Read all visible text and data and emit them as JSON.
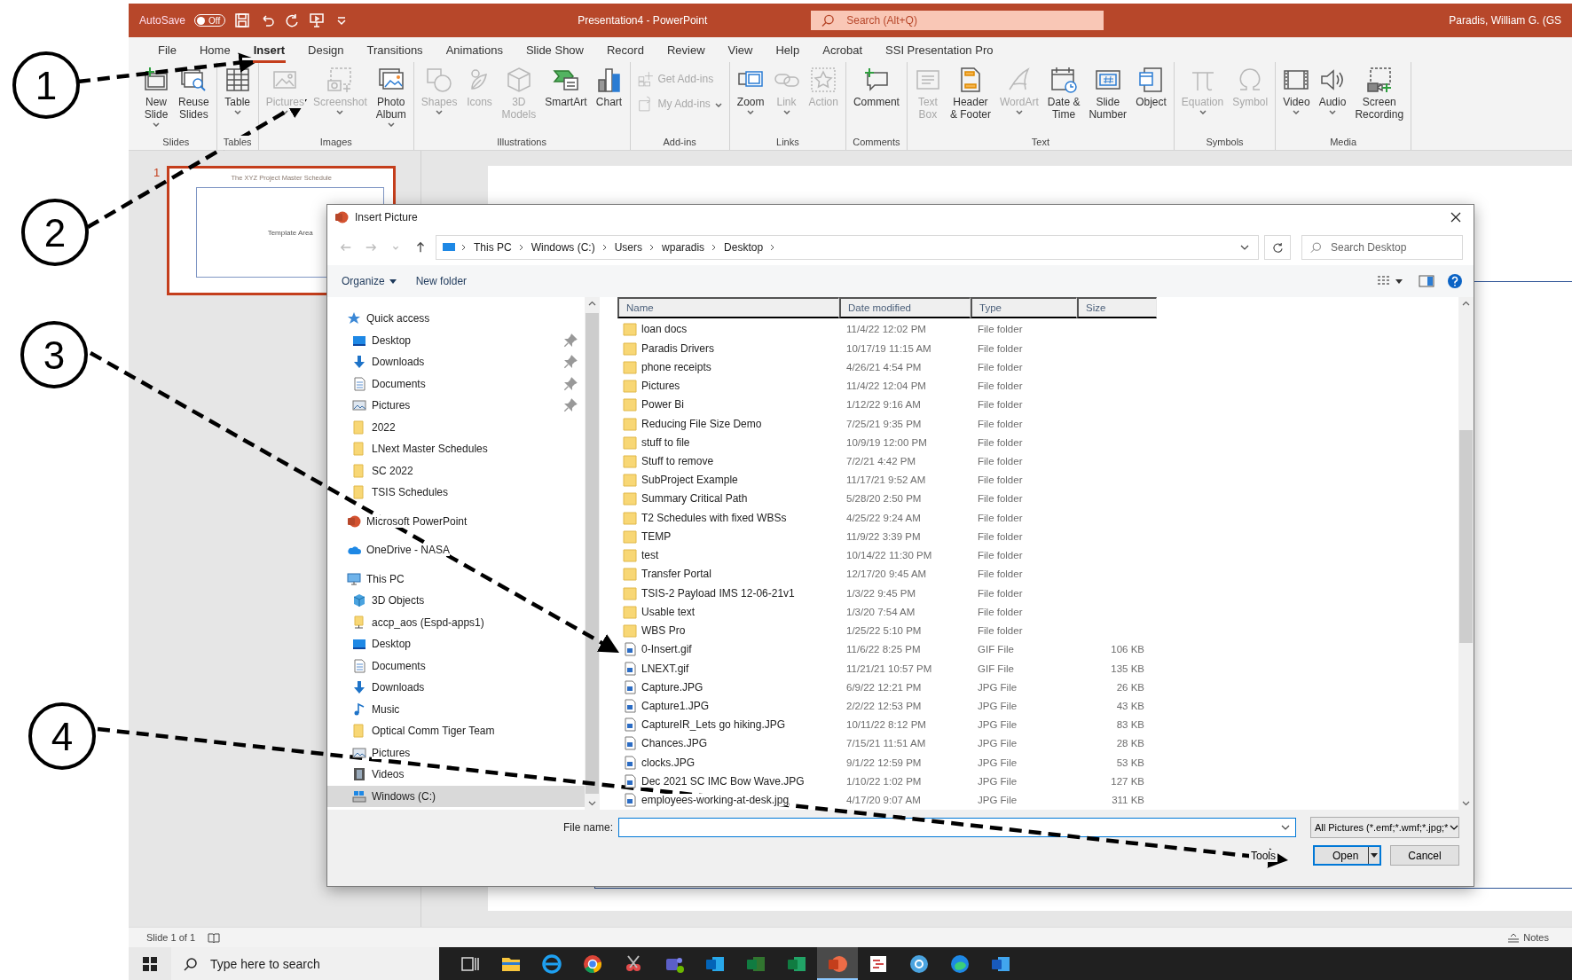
{
  "title_bar": {
    "autosave": {
      "label": "AutoSave",
      "toggle": "Off",
      "on": false
    },
    "title": "Presentation4  -  PowerPoint",
    "search": {
      "placeholder": "Search (Alt+Q)"
    },
    "user": "Paradis, William G. (GS"
  },
  "tabs": [
    {
      "label": "File",
      "selected": false
    },
    {
      "label": "Home",
      "selected": false
    },
    {
      "label": "Insert",
      "selected": true
    },
    {
      "label": "Design",
      "selected": false
    },
    {
      "label": "Transitions",
      "selected": false
    },
    {
      "label": "Animations",
      "selected": false
    },
    {
      "label": "Slide Show",
      "selected": false
    },
    {
      "label": "Record",
      "selected": false
    },
    {
      "label": "Review",
      "selected": false
    },
    {
      "label": "View",
      "selected": false
    },
    {
      "label": "Help",
      "selected": false
    },
    {
      "label": "Acrobat",
      "selected": false
    },
    {
      "label": "SSI Presentation Pro",
      "selected": false
    }
  ],
  "ribbon": {
    "groups": [
      {
        "label": "Slides",
        "buttons": [
          {
            "label": "New\nSlide",
            "kind": "large",
            "disabled": false,
            "dropdown": true
          },
          {
            "label": "Reuse\nSlides",
            "kind": "large",
            "disabled": false,
            "dropdown": false
          }
        ]
      },
      {
        "label": "Tables",
        "buttons": [
          {
            "label": "Table",
            "kind": "large",
            "disabled": false,
            "dropdown": true
          }
        ]
      },
      {
        "label": "Images",
        "buttons": [
          {
            "label": "Pictures",
            "kind": "large",
            "disabled": true,
            "dropdown": true
          },
          {
            "label": "Screenshot",
            "kind": "large",
            "disabled": true,
            "dropdown": true
          },
          {
            "label": "Photo\nAlbum",
            "kind": "large",
            "disabled": false,
            "dropdown": true
          }
        ]
      },
      {
        "label": "Illustrations",
        "buttons": [
          {
            "label": "Shapes",
            "kind": "large",
            "disabled": true,
            "dropdown": true
          },
          {
            "label": "Icons",
            "kind": "large",
            "disabled": true,
            "dropdown": false
          },
          {
            "label": "3D\nModels",
            "kind": "large",
            "disabled": true,
            "dropdown": false
          },
          {
            "label": "SmartArt",
            "kind": "large",
            "disabled": false,
            "dropdown": false
          },
          {
            "label": "Chart",
            "kind": "large",
            "disabled": false,
            "dropdown": false
          }
        ]
      },
      {
        "label": "Add-ins",
        "buttons": [
          {
            "label": "Get Add-ins",
            "kind": "small",
            "disabled": true,
            "dropdown": false
          },
          {
            "label": "My Add-ins",
            "kind": "small",
            "disabled": true,
            "dropdown": true
          }
        ]
      },
      {
        "label": "Links",
        "buttons": [
          {
            "label": "Zoom",
            "kind": "large",
            "disabled": false,
            "dropdown": true
          },
          {
            "label": "Link",
            "kind": "large",
            "disabled": true,
            "dropdown": true
          },
          {
            "label": "Action",
            "kind": "large",
            "disabled": true,
            "dropdown": false
          }
        ]
      },
      {
        "label": "Comments",
        "buttons": [
          {
            "label": "Comment",
            "kind": "large",
            "disabled": false,
            "dropdown": false
          }
        ]
      },
      {
        "label": "Text",
        "buttons": [
          {
            "label": "Text\nBox",
            "kind": "large",
            "disabled": true,
            "dropdown": false
          },
          {
            "label": "Header\n& Footer",
            "kind": "large",
            "disabled": false,
            "dropdown": false
          },
          {
            "label": "WordArt",
            "kind": "large",
            "disabled": true,
            "dropdown": true
          },
          {
            "label": "Date &\nTime",
            "kind": "large",
            "disabled": false,
            "dropdown": false
          },
          {
            "label": "Slide\nNumber",
            "kind": "large",
            "disabled": false,
            "dropdown": false
          },
          {
            "label": "Object",
            "kind": "large",
            "disabled": false,
            "dropdown": false
          }
        ]
      },
      {
        "label": "Symbols",
        "buttons": [
          {
            "label": "Equation",
            "kind": "large",
            "disabled": true,
            "dropdown": true
          },
          {
            "label": "Symbol",
            "kind": "large",
            "disabled": true,
            "dropdown": false
          }
        ]
      },
      {
        "label": "Media",
        "buttons": [
          {
            "label": "Video",
            "kind": "large",
            "disabled": false,
            "dropdown": true
          },
          {
            "label": "Audio",
            "kind": "large",
            "disabled": false,
            "dropdown": true
          },
          {
            "label": "Screen\nRecording",
            "kind": "large",
            "disabled": false,
            "dropdown": false
          }
        ]
      }
    ]
  },
  "slide_pane": {
    "slides": [
      {
        "number": "1",
        "title": "The XYZ Project Master Schedule",
        "placeholder_text": "Template Area",
        "selected": true
      }
    ]
  },
  "dialog": {
    "title": "Insert Picture",
    "breadcrumb": [
      "This PC",
      "Windows (C:)",
      "Users",
      "wparadis",
      "Desktop"
    ],
    "search": {
      "placeholder": "Search Desktop"
    },
    "toolbar": {
      "organize": "Organize",
      "new_folder": "New folder"
    },
    "nav": [
      {
        "label": "Quick access",
        "kind": "quick",
        "selected": false,
        "children": [
          {
            "label": "Desktop",
            "kind": "desktop",
            "pinned": true,
            "selected": false
          },
          {
            "label": "Downloads",
            "kind": "downloads",
            "pinned": true,
            "selected": false
          },
          {
            "label": "Documents",
            "kind": "documents",
            "pinned": true,
            "selected": false
          },
          {
            "label": "Pictures",
            "kind": "pictures",
            "pinned": true,
            "selected": false
          },
          {
            "label": "2022",
            "kind": "folder",
            "pinned": false,
            "selected": false
          },
          {
            "label": "LNext Master Schedules",
            "kind": "folder",
            "pinned": false,
            "selected": false
          },
          {
            "label": "SC 2022",
            "kind": "folder",
            "pinned": false,
            "selected": false
          },
          {
            "label": "TSIS Schedules",
            "kind": "folder",
            "pinned": false,
            "selected": false
          }
        ]
      },
      {
        "label": "Microsoft PowerPoint",
        "kind": "app",
        "selected": false
      },
      {
        "label": "OneDrive - NASA",
        "kind": "cloud",
        "selected": false
      },
      {
        "label": "This PC",
        "kind": "pc",
        "selected": false,
        "children": [
          {
            "label": "3D Objects",
            "kind": "objects",
            "selected": false
          },
          {
            "label": "accp_aos (Espd-apps1)",
            "kind": "netfolder",
            "selected": false
          },
          {
            "label": "Desktop",
            "kind": "desktop",
            "selected": false
          },
          {
            "label": "Documents",
            "kind": "documents",
            "selected": false
          },
          {
            "label": "Downloads",
            "kind": "downloads",
            "selected": false
          },
          {
            "label": "Music",
            "kind": "music",
            "selected": false
          },
          {
            "label": "Optical Comm Tiger Team",
            "kind": "folder",
            "selected": false
          },
          {
            "label": "Pictures",
            "kind": "pictures",
            "selected": false
          },
          {
            "label": "Videos",
            "kind": "videos",
            "selected": false
          },
          {
            "label": "Windows (C:)",
            "kind": "drive",
            "selected": true
          }
        ]
      }
    ],
    "columns": [
      "Name",
      "Date modified",
      "Type",
      "Size"
    ],
    "files": [
      {
        "name": "loan docs",
        "kind": "folder",
        "date": "11/4/22 12:02 PM",
        "type": "File folder"
      },
      {
        "name": "Paradis Drivers",
        "kind": "folder",
        "date": "10/17/19 11:15 AM",
        "type": "File folder"
      },
      {
        "name": "phone receipts",
        "kind": "folder",
        "date": "4/26/21 4:54 PM",
        "type": "File folder"
      },
      {
        "name": "Pictures",
        "kind": "folder",
        "date": "11/4/22 12:04 PM",
        "type": "File folder"
      },
      {
        "name": "Power Bi",
        "kind": "folder",
        "date": "1/12/22 9:16 AM",
        "type": "File folder"
      },
      {
        "name": "Reducing File Size Demo",
        "kind": "folder",
        "date": "7/25/21 9:35 PM",
        "type": "File folder"
      },
      {
        "name": "stuff to file",
        "kind": "folder",
        "date": "10/9/19 12:00 PM",
        "type": "File folder"
      },
      {
        "name": "Stuff to remove",
        "kind": "folder",
        "date": "7/2/21 4:42 PM",
        "type": "File folder"
      },
      {
        "name": "SubProject Example",
        "kind": "folder",
        "date": "11/17/21 9:52 AM",
        "type": "File folder"
      },
      {
        "name": "Summary Critical Path",
        "kind": "folder",
        "date": "5/28/20 2:50 PM",
        "type": "File folder"
      },
      {
        "name": "T2 Schedules with fixed WBSs",
        "kind": "folder",
        "date": "4/25/22 9:24 AM",
        "type": "File folder"
      },
      {
        "name": "TEMP",
        "kind": "folder",
        "date": "11/9/22 3:39 PM",
        "type": "File folder"
      },
      {
        "name": "test",
        "kind": "folder",
        "date": "10/14/22 11:30 PM",
        "type": "File folder"
      },
      {
        "name": "Transfer Portal",
        "kind": "folder",
        "date": "12/17/20 9:45 AM",
        "type": "File folder"
      },
      {
        "name": "TSIS-2 Payload IMS 12-06-21v1",
        "kind": "folder",
        "date": "1/3/22 9:45 PM",
        "type": "File folder"
      },
      {
        "name": "Usable text",
        "kind": "folder",
        "date": "1/3/20 7:54 AM",
        "type": "File folder"
      },
      {
        "name": "WBS Pro",
        "kind": "folder",
        "date": "1/25/22 5:10 PM",
        "type": "File folder"
      },
      {
        "name": "0-Insert.gif",
        "kind": "image",
        "date": "11/6/22 8:25 PM",
        "type": "GIF File",
        "size": "106 KB"
      },
      {
        "name": "LNEXT.gif",
        "kind": "image",
        "date": "11/21/21 10:57 PM",
        "type": "GIF File",
        "size": "135 KB"
      },
      {
        "name": "Capture.JPG",
        "kind": "image",
        "date": "6/9/22 12:21 PM",
        "type": "JPG File",
        "size": "26 KB"
      },
      {
        "name": "Capture1.JPG",
        "kind": "image",
        "date": "2/2/22 12:53 PM",
        "type": "JPG File",
        "size": "43 KB"
      },
      {
        "name": "CaptureIR_Lets go hiking.JPG",
        "kind": "image",
        "date": "10/11/22 8:12 PM",
        "type": "JPG File",
        "size": "83 KB"
      },
      {
        "name": "Chances.JPG",
        "kind": "image",
        "date": "7/15/21 11:51 AM",
        "type": "JPG File",
        "size": "28 KB"
      },
      {
        "name": "clocks.JPG",
        "kind": "image",
        "date": "9/1/22 12:59 PM",
        "type": "JPG File",
        "size": "53 KB"
      },
      {
        "name": "Dec 2021 SC IMC Bow Wave.JPG",
        "kind": "image",
        "date": "1/10/22 1:02 PM",
        "type": "JPG File",
        "size": "127 KB"
      },
      {
        "name": "employees-working-at-desk.jpg",
        "kind": "image",
        "date": "4/17/20 9:07 AM",
        "type": "JPG File",
        "size": "311 KB"
      }
    ],
    "file_name_label": "File name:",
    "filter": "All Pictures (*.emf;*.wmf;*.jpg;*",
    "tools": "Tools",
    "buttons": [
      "Open",
      "Cancel"
    ]
  },
  "status_bar": {
    "slide": "Slide 1 of 1",
    "notes": "Notes"
  },
  "taskbar": {
    "search": {
      "placeholder": "Type here to search"
    },
    "apps": [
      {
        "active": false
      },
      {
        "active": false
      },
      {
        "active": false
      },
      {
        "active": false
      },
      {
        "active": false
      },
      {
        "active": false
      },
      {
        "active": false
      },
      {
        "active": false
      },
      {
        "active": false
      },
      {
        "active": true
      },
      {
        "active": false
      },
      {
        "active": false
      },
      {
        "active": false
      },
      {
        "active": false
      }
    ]
  },
  "annotations": [
    {
      "label": "1"
    },
    {
      "label": "2"
    },
    {
      "label": "3"
    },
    {
      "label": "4"
    }
  ]
}
